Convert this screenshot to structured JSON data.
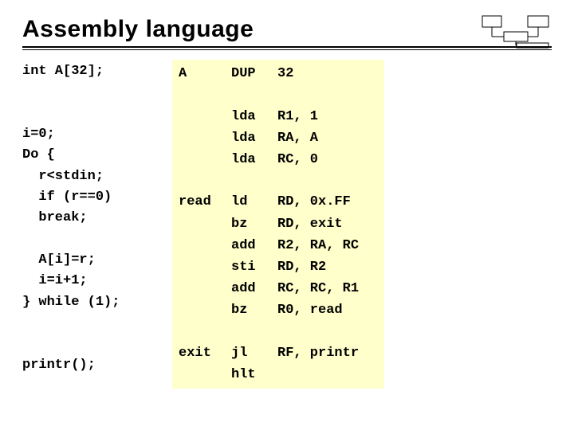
{
  "title": "Assembly language",
  "source_lines": [
    "int A[32];",
    "",
    "",
    "i=0;",
    "Do {",
    "  r<stdin;",
    "  if (r==0)",
    "  break;",
    "",
    "  A[i]=r;",
    "  i=i+1;",
    "} while (1);",
    "",
    "",
    "printr();"
  ],
  "asm": [
    {
      "label": "A",
      "op": "DUP",
      "args": "32"
    },
    {
      "blank": true
    },
    {
      "label": "",
      "op": "lda",
      "args": "R1, 1"
    },
    {
      "label": "",
      "op": "lda",
      "args": "RA, A"
    },
    {
      "label": "",
      "op": "lda",
      "args": "RC, 0"
    },
    {
      "blank": true
    },
    {
      "label": "read",
      "op": "ld",
      "args": "RD, 0x.FF"
    },
    {
      "label": "",
      "op": "bz",
      "args": "RD, exit"
    },
    {
      "label": "",
      "op": "add",
      "args": "R2, RA, RC"
    },
    {
      "label": "",
      "op": "sti",
      "args": "RD, R2"
    },
    {
      "label": "",
      "op": "add",
      "args": "RC, RC, R1"
    },
    {
      "label": "",
      "op": "bz",
      "args": "R0, read"
    },
    {
      "blank": true
    },
    {
      "label": "exit",
      "op": "jl",
      "args": "RF, printr"
    },
    {
      "label": "",
      "op": "hlt",
      "args": ""
    }
  ]
}
